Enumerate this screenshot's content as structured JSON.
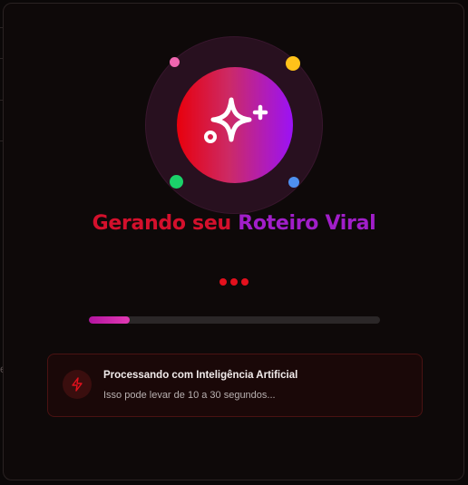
{
  "modal": {
    "title_part1": "Gerando seu ",
    "title_part2": "Roteiro Viral",
    "icon": "sparkles-icon",
    "progress_percent": 14,
    "colors": {
      "accent_red": "#e3101d",
      "accent_purple": "#9b12f6",
      "progress": "#d02aae"
    }
  },
  "orbit_dots": [
    "pink-dot",
    "yellow-dot",
    "green-dot",
    "blue-dot"
  ],
  "info_card": {
    "icon": "bolt-icon",
    "title": "Processando com Inteligência Artificial",
    "subtitle": "Isso pode levar de 10 a 30 segundos..."
  },
  "background": {
    "edge_letter": "e"
  }
}
